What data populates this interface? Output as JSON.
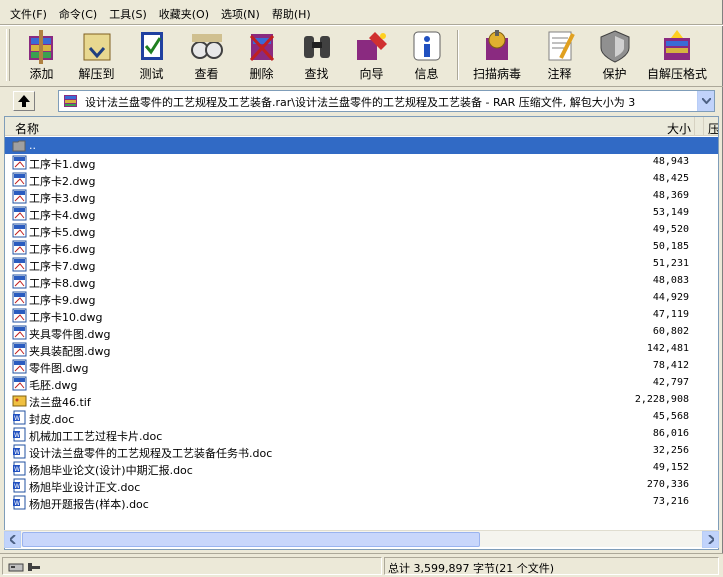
{
  "menu": [
    "文件(F)",
    "命令(C)",
    "工具(S)",
    "收藏夹(O)",
    "选项(N)",
    "帮助(H)"
  ],
  "toolbar": [
    {
      "label": "添加",
      "icon": "add-archive-icon"
    },
    {
      "label": "解压到",
      "icon": "extract-to-icon"
    },
    {
      "label": "测试",
      "icon": "test-icon"
    },
    {
      "label": "查看",
      "icon": "view-icon"
    },
    {
      "label": "删除",
      "icon": "delete-icon"
    },
    {
      "label": "查找",
      "icon": "find-icon"
    },
    {
      "label": "向导",
      "icon": "wizard-icon"
    },
    {
      "label": "信息",
      "icon": "info-icon"
    },
    {
      "label": "扫描病毒",
      "icon": "virus-scan-icon"
    },
    {
      "label": "注释",
      "icon": "comment-icon"
    },
    {
      "label": "保护",
      "icon": "protect-icon"
    },
    {
      "label": "自解压格式",
      "icon": "sfx-icon"
    }
  ],
  "address": "设计法兰盘零件的工艺规程及工艺装备.rar\\设计法兰盘零件的工艺规程及工艺装备 - RAR 压缩文件, 解包大小为 3",
  "columns": {
    "name": "名称",
    "size": "大小",
    "packed": "压"
  },
  "files": [
    {
      "name": "..",
      "size": "",
      "type": "folder"
    },
    {
      "name": "工序卡1.dwg",
      "size": "48,943",
      "type": "dwg"
    },
    {
      "name": "工序卡2.dwg",
      "size": "48,425",
      "type": "dwg"
    },
    {
      "name": "工序卡3.dwg",
      "size": "48,369",
      "type": "dwg"
    },
    {
      "name": "工序卡4.dwg",
      "size": "53,149",
      "type": "dwg"
    },
    {
      "name": "工序卡5.dwg",
      "size": "49,520",
      "type": "dwg"
    },
    {
      "name": "工序卡6.dwg",
      "size": "50,185",
      "type": "dwg"
    },
    {
      "name": "工序卡7.dwg",
      "size": "51,231",
      "type": "dwg"
    },
    {
      "name": "工序卡8.dwg",
      "size": "48,083",
      "type": "dwg"
    },
    {
      "name": "工序卡9.dwg",
      "size": "44,929",
      "type": "dwg"
    },
    {
      "name": "工序卡10.dwg",
      "size": "47,119",
      "type": "dwg"
    },
    {
      "name": "夹具零件图.dwg",
      "size": "60,802",
      "type": "dwg"
    },
    {
      "name": "夹具装配图.dwg",
      "size": "142,481",
      "type": "dwg"
    },
    {
      "name": "零件图.dwg",
      "size": "78,412",
      "type": "dwg"
    },
    {
      "name": "毛胚.dwg",
      "size": "42,797",
      "type": "dwg"
    },
    {
      "name": "法兰盘46.tif",
      "size": "2,228,908",
      "type": "tif"
    },
    {
      "name": "封皮.doc",
      "size": "45,568",
      "type": "doc"
    },
    {
      "name": "机械加工工艺过程卡片.doc",
      "size": "86,016",
      "type": "doc"
    },
    {
      "name": "设计法兰盘零件的工艺规程及工艺装备任务书.doc",
      "size": "32,256",
      "type": "doc"
    },
    {
      "name": "杨旭毕业论文(设计)中期汇报.doc",
      "size": "49,152",
      "type": "doc"
    },
    {
      "name": "杨旭毕业设计正文.doc",
      "size": "270,336",
      "type": "doc"
    },
    {
      "name": "杨旭开题报告(样本).doc",
      "size": "73,216",
      "type": "doc"
    }
  ],
  "status": {
    "total": "总计 3,599,897 字节(21 个文件)"
  }
}
